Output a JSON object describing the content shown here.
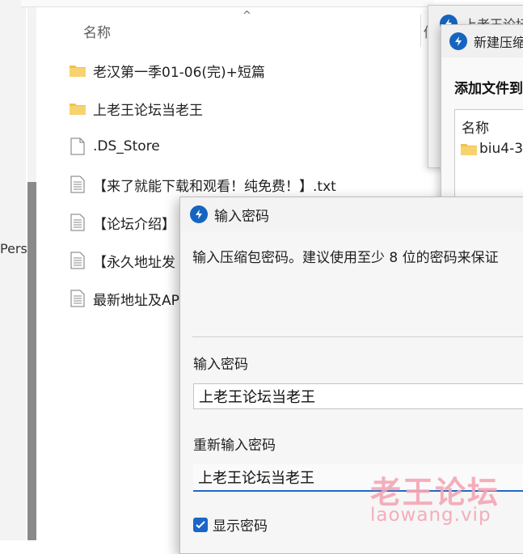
{
  "explorer": {
    "column_name": "名称",
    "column_partial": "修",
    "sort_glyph": "^",
    "side_label": "Pers",
    "files": [
      {
        "name": "老汉第一季01-06(完)+短篇",
        "icon": "folder-icon"
      },
      {
        "name": "上老王论坛当老王",
        "icon": "folder-icon"
      },
      {
        "name": ".DS_Store",
        "icon": "blank-file-icon"
      },
      {
        "name": "【来了就能下载和观看！纯免费！】.txt",
        "icon": "text-file-icon"
      },
      {
        "name": "【论坛介绍】",
        "icon": "text-file-icon"
      },
      {
        "name": "【永久地址发",
        "icon": "text-file-icon"
      },
      {
        "name": "最新地址及AP",
        "icon": "text-file-icon"
      }
    ]
  },
  "back_dialog_1": {
    "title": "上老王论坛"
  },
  "back_dialog_2": {
    "title": "新建压缩",
    "heading": "添加文件到",
    "list_header": "名称",
    "list_item": "biu4-3"
  },
  "password_dialog": {
    "title": "输入密码",
    "description": "输入压缩包密码。建议使用至少 8 位的密码来保证",
    "label_password": "输入密码",
    "password_value": "上老王论坛当老王",
    "label_confirm": "重新输入密码",
    "confirm_value": "上老王论坛当老王",
    "show_password_label": "显示密码",
    "show_password_checked": true
  },
  "watermark": {
    "main": "老王论坛",
    "sub": "laowang.vip"
  },
  "colors": {
    "accent": "#1a67c7",
    "folder": "#f2c14e",
    "watermark": "#f4a6b5"
  }
}
